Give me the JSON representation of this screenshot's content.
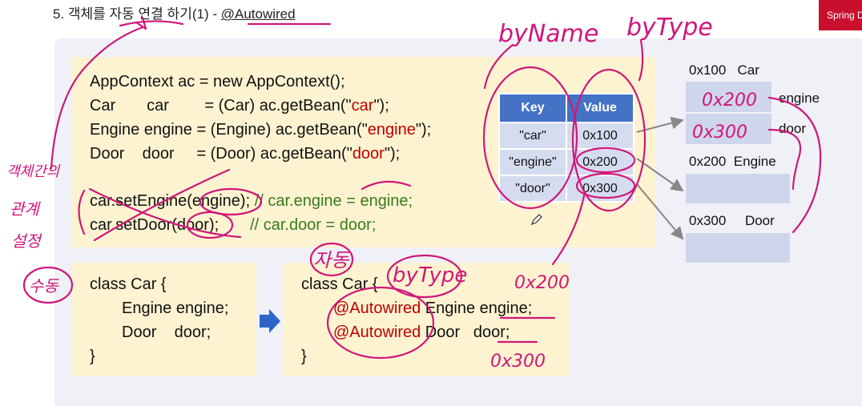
{
  "slide": {
    "title_prefix": "5. 객체를 자동 연결 하기(1) - ",
    "title_highlight": "@Autowired",
    "corner_label": "Spring D"
  },
  "code": {
    "line1": "AppContext ac = new AppContext();",
    "line2_pre": "Car       car        = (Car) ac.getBean(\"",
    "line2_key": "car",
    "line2_post": "\");",
    "line3_pre": "Engine engine = (Engine) ac.getBean(\"",
    "line3_key": "engine",
    "line3_post": "\");",
    "line4_pre": "Door    door     = (Door) ac.getBean(\"",
    "line4_key": "door",
    "line4_post": "\");",
    "line5_code": "car.setEngine(engine);",
    "line5_comment": " // car.engine = engine;",
    "line6_code": "car.setDoor(door);",
    "line6_comment": "       // car.door = door;"
  },
  "class_before": {
    "line1": "class Car {",
    "line2": "Engine engine;",
    "line3": "Door    door;",
    "line4": "}"
  },
  "class_after": {
    "line1": "class Car {",
    "annotation": "@Autowired",
    "line2_rest": " Engine engine;",
    "line3_rest": " Door   door;",
    "line4": "}"
  },
  "map_table": {
    "headers": [
      "Key",
      "Value"
    ],
    "rows": [
      {
        "key": "\"car\"",
        "value": "0x100"
      },
      {
        "key": "\"engine\"",
        "value": "0x200"
      },
      {
        "key": "\"door\"",
        "value": "0x300"
      }
    ]
  },
  "memory": {
    "car_addr": "0x100",
    "car_type": "Car",
    "car_field1": "engine",
    "car_field2": "door",
    "engine_addr": "0x200",
    "engine_type": "Engine",
    "door_addr": "0x300",
    "door_type": "Door"
  },
  "handwriting": {
    "by_name": "byName",
    "by_type_top": "byType",
    "by_type_mid": "byType",
    "auto": "자동",
    "manual": "수동",
    "side_note": [
      "객체간의",
      "관계",
      "설정"
    ],
    "val_0x200_a": "0x200",
    "val_0x300_a": "0x300",
    "val_0x200_b": "0x200",
    "val_0x300_b": "0x300"
  },
  "colors": {
    "ink": "#d0177a",
    "header_blue": "#4472c4",
    "code_red": "#c00000",
    "comment_green": "#3a7a1e",
    "arrow_blue": "#2e64c8",
    "corner_red": "#c8102e"
  }
}
